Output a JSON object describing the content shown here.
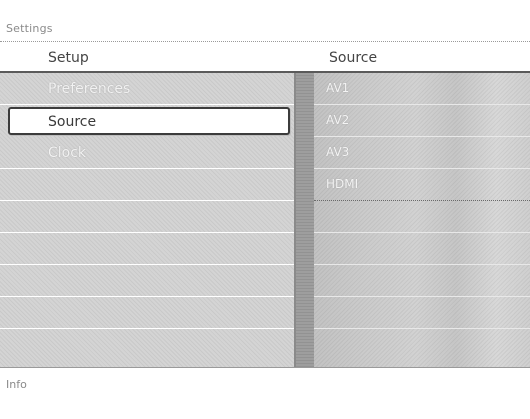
{
  "window": {
    "title": "Settings",
    "info_label": "Info"
  },
  "headers": {
    "left": "Setup",
    "right": "Source"
  },
  "menu": {
    "items": [
      {
        "label": "Preferences",
        "selected": false
      },
      {
        "label": "Source",
        "selected": true
      },
      {
        "label": "Clock",
        "selected": false
      },
      {
        "label": "",
        "selected": false
      },
      {
        "label": "",
        "selected": false
      },
      {
        "label": "",
        "selected": false
      },
      {
        "label": "",
        "selected": false
      },
      {
        "label": "",
        "selected": false
      },
      {
        "label": "",
        "selected": false
      }
    ]
  },
  "sources": {
    "items": [
      {
        "label": "AV1"
      },
      {
        "label": "AV2"
      },
      {
        "label": "AV3"
      },
      {
        "label": "HDMI"
      },
      {
        "label": ""
      },
      {
        "label": ""
      },
      {
        "label": ""
      },
      {
        "label": ""
      },
      {
        "label": ""
      }
    ]
  },
  "colors": {
    "selection_border": "#3c3c3c",
    "pane_gray": "#d4d4d4",
    "rule": "#5a5a5a"
  }
}
